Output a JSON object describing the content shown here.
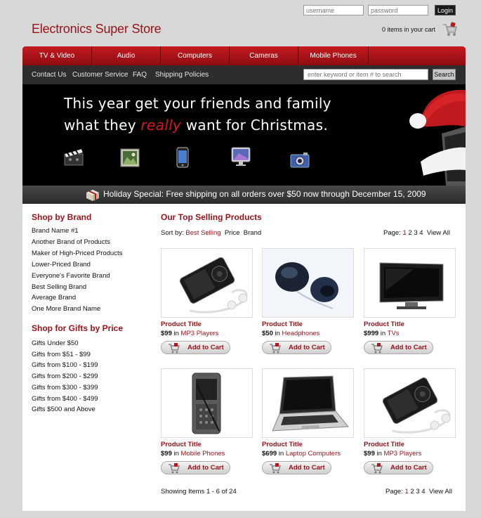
{
  "header": {
    "username_placeholder": "username",
    "password_placeholder": "password",
    "login_label": "Login",
    "logo": "Electronics Super Store",
    "cart_text": "0 items in your cart"
  },
  "nav": {
    "main": [
      "TV & Video",
      "Audio",
      "Computers",
      "Cameras",
      "Mobile Phones"
    ],
    "sub": [
      "Contact Us",
      "Customer Service",
      "FAQ",
      "Shipping Policies"
    ],
    "search_placeholder": "enter keyword or item # to search",
    "search_label": "Search"
  },
  "banner": {
    "line1": "This year get your friends and family",
    "line2_pre": "what they",
    "line2_em": "really",
    "line2_post": "want for Christmas.",
    "icons": [
      "film-icon",
      "photo-icon",
      "mobile-phone-icon",
      "monitor-icon",
      "camera-icon",
      "santa-hat-icon"
    ]
  },
  "promo": "Holiday Special: Free shipping on all orders over $50 now through December 15, 2009",
  "sidebar": {
    "brand_heading": "Shop by Brand",
    "brands": [
      "Brand Name #1",
      "Another Brand of Products",
      "Maker of High-Priced Products",
      "Lower-Priced Brand",
      "Everyone's Favorite Brand",
      "Best Selling Brand",
      "Average Brand",
      "One More Brand Name"
    ],
    "price_heading": "Shop for Gifts by Price",
    "prices": [
      "Gifts Under $50",
      "Gifts from $51 - $99",
      "Gifts from $100 - $199",
      "Gifts from $200 - $299",
      "Gifts from $300 - $399",
      "Gifts from $400 - $499",
      "Gifts $500 and Above"
    ]
  },
  "content": {
    "heading": "Our Top Selling Products",
    "sort_label": "Sort by:",
    "sort_options": [
      "Best Selling",
      "Price",
      "Brand"
    ],
    "page_label": "Page:",
    "pages": [
      "1",
      "2",
      "3",
      "4"
    ],
    "view_all": "View All",
    "showing": "Showing Items 1 - 6 of 24",
    "add_to_cart": "Add to Cart",
    "products": [
      {
        "title": "Product Title",
        "price": "$99",
        "in": "in",
        "category": "MP3 Players",
        "image": "mp3-player"
      },
      {
        "title": "Product Title",
        "price": "$50",
        "in": "in",
        "category": "Headphones",
        "image": "headphones"
      },
      {
        "title": "Product Title",
        "price": "$999",
        "in": "in",
        "category": "TVs",
        "image": "tv"
      },
      {
        "title": "Product Title",
        "price": "$99",
        "in": "in",
        "category": "Mobile Phones",
        "image": "mobile-phone"
      },
      {
        "title": "Product Title",
        "price": "$699",
        "in": "in",
        "category": "Laptop Computers",
        "image": "laptop"
      },
      {
        "title": "Product Title",
        "price": "$99",
        "in": "in",
        "category": "MP3 Players",
        "image": "mp3-player"
      }
    ]
  },
  "colors": {
    "brand_red": "#9b1117",
    "nav_red": "#c41b20",
    "subnav": "#2d2d2d",
    "page_bg": "#d8d8d8"
  }
}
